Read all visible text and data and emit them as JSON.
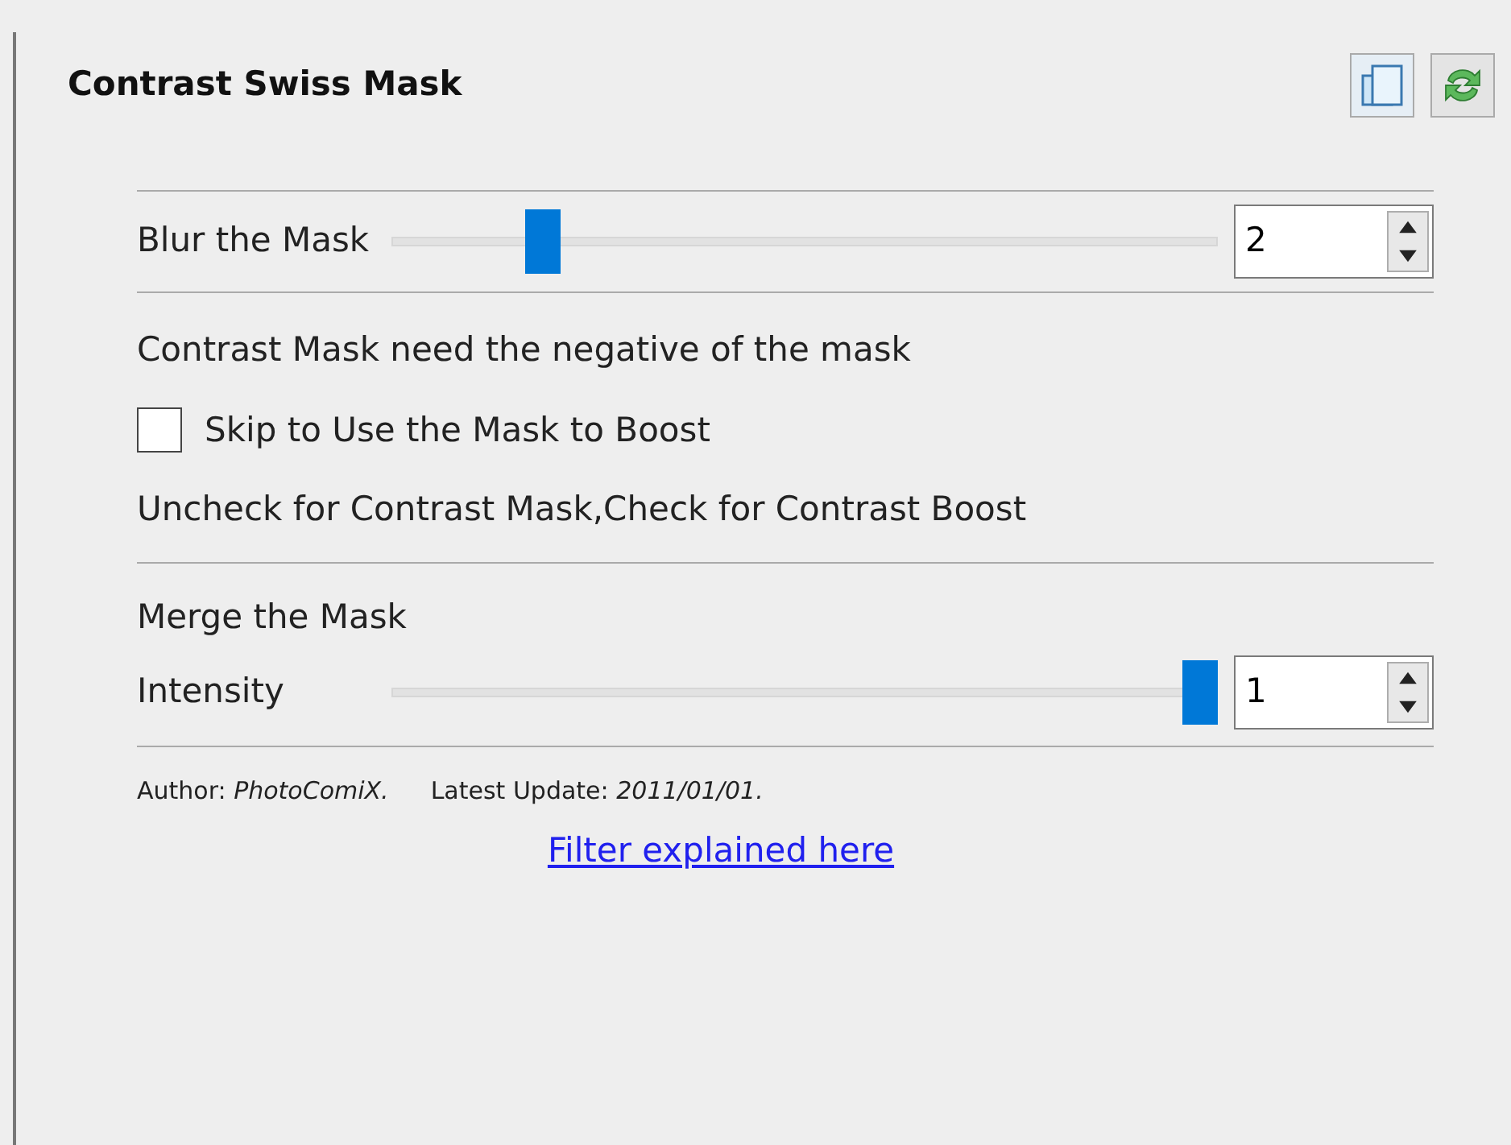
{
  "title": "Contrast Swiss Mask",
  "sliders": [
    {
      "label": "Blur the Mask",
      "level": 0.17,
      "value": "2"
    }
  ],
  "note": "Contrast Mask need the negative of the mask",
  "checkbox": {
    "label": "Skip to Use the Mask to Boost",
    "checked": false
  },
  "hint": "Uncheck for Contrast Mask,Check for Contrast Boost",
  "merge": {
    "heading": "Merge the Mask",
    "sliders": [
      {
        "label": "Intensity",
        "level": 1,
        "value": "1"
      }
    ]
  },
  "author": "Author: *PhotoComiX.*",
  "update": "Latest Update: *2011/01/01.*",
  "link": "Filter explained here"
}
